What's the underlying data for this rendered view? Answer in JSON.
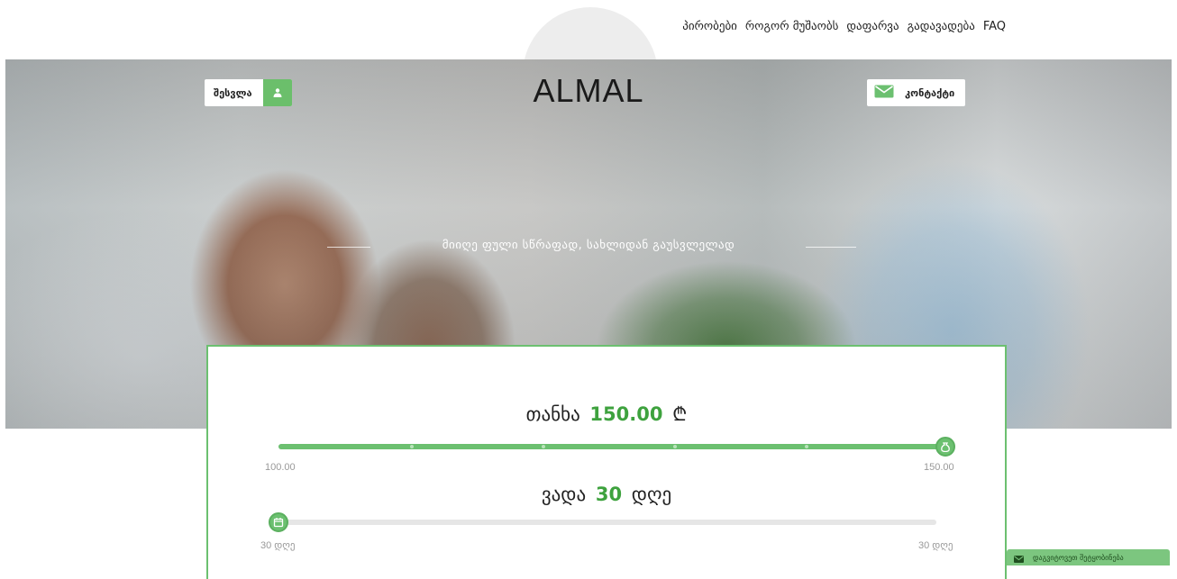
{
  "nav": {
    "items": [
      "პირობები",
      "როგორ მუშაობს",
      "დაფარვა",
      "გადავადება",
      "FAQ"
    ]
  },
  "header": {
    "login_label": "შესვლა",
    "logo": "ALMAL",
    "contact_label": "კონტაქტი"
  },
  "hero": {
    "tagline": "მიიღე ფული სწრაფად, სახლიდან გაუსვლელად"
  },
  "calculator": {
    "amount": {
      "label": "თანხა",
      "value": "150.00",
      "currency": "₾",
      "min_label": "100.00",
      "max_label": "150.00",
      "fraction": 1.0
    },
    "term": {
      "label": "ვადა",
      "value": "30",
      "unit": "დღე",
      "min_label": "30 დღე",
      "max_label": "30 დღე",
      "fraction": 0.0
    }
  },
  "feedback": {
    "label": "დაგვიტოვეთ შეტყობინება"
  },
  "colors": {
    "accent": "#6cc070",
    "accent_dark": "#3ea23e"
  }
}
